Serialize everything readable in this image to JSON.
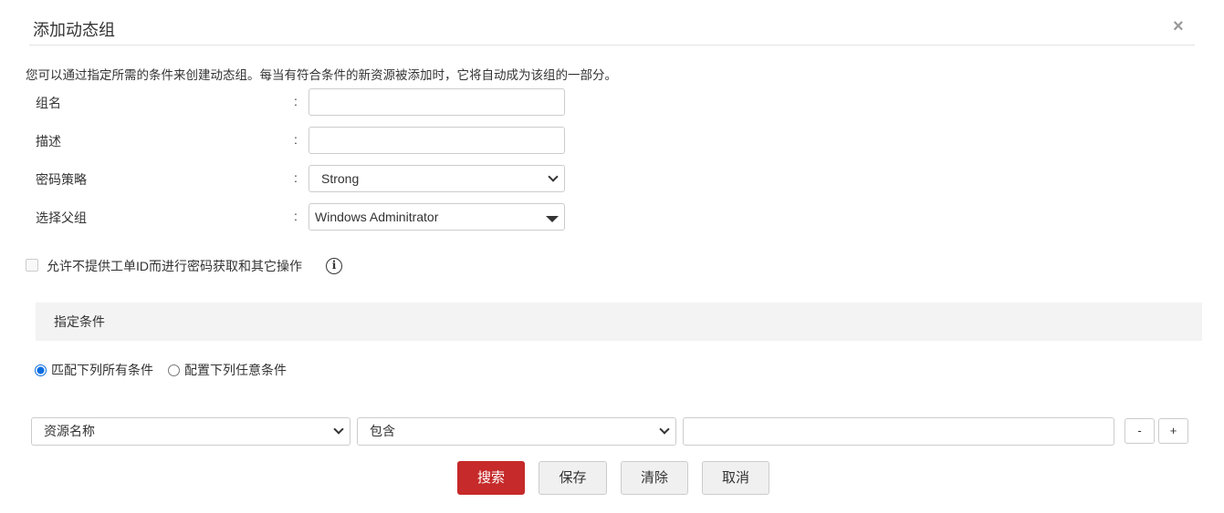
{
  "dialog": {
    "title": "添加动态组",
    "close": "×",
    "description": "您可以通过指定所需的条件来创建动态组。每当有符合条件的新资源被添加时，它将自动成为该组的一部分。"
  },
  "form": {
    "colon": ":",
    "group_name": {
      "label": "组名",
      "value": ""
    },
    "description": {
      "label": "描述",
      "value": ""
    },
    "password_policy": {
      "label": "密码策略",
      "value": "Strong"
    },
    "parent_group": {
      "label": "选择父组",
      "value": "Windows Adminitrator"
    },
    "allow_without_ticket": {
      "label": "允许不提供工单ID而进行密码获取和其它操作",
      "checked": false,
      "info": "i"
    }
  },
  "criteria": {
    "header": "指定条件",
    "match_all": "匹配下列所有条件",
    "match_any": "配置下列任意条件",
    "selected": "match_all",
    "row": {
      "field": "资源名称",
      "operator": "包含",
      "value": "",
      "remove": "-",
      "add": "+"
    }
  },
  "buttons": {
    "search": "搜索",
    "save": "保存",
    "clear": "清除",
    "cancel": "取消"
  },
  "colors": {
    "primary": "#c62a2a",
    "radio": "#0a6de0"
  }
}
